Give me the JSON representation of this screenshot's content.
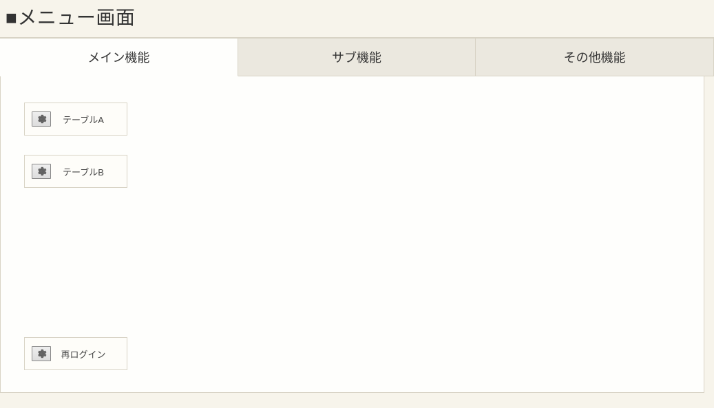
{
  "header": {
    "title": "■メニュー画面"
  },
  "tabs": {
    "main": "メイン機能",
    "sub": "サブ機能",
    "other": "その他機能"
  },
  "buttons": {
    "table_a": "テーブルA",
    "table_b": "テーブルB",
    "relogin": "再ログイン"
  }
}
